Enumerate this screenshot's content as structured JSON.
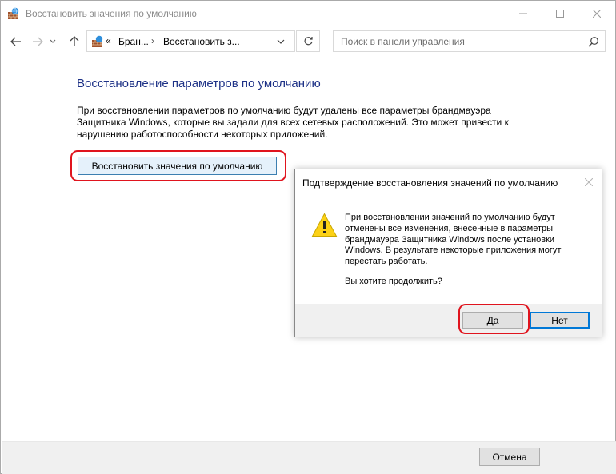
{
  "window": {
    "title": "Восстановить значения по умолчанию"
  },
  "nav": {
    "breadcrumb_overflow": "«",
    "breadcrumb_1": "Бран...",
    "breadcrumb_2": "Восстановить з...",
    "search_placeholder": "Поиск в панели управления"
  },
  "main": {
    "heading": "Восстановление параметров по умолчанию",
    "description": "При восстановлении параметров по умолчанию будут удалены все параметры брандмауэра Защитника Windows, которые вы задали для всех сетевых расположений. Это может привести к нарушению работоспособности некоторых приложений.",
    "restore_button": "Восстановить значения по умолчанию"
  },
  "dialog": {
    "title": "Подтверждение восстановления значений по умолчанию",
    "message": "При восстановлении значений по умолчанию будут отменены все изменения, внесенные в параметры брандмауэра Защитника Windows после установки Windows. В результате некоторые приложения могут перестать работать.",
    "question": "Вы хотите продолжить?",
    "yes_button": "Да",
    "no_button": "Нет"
  },
  "footer": {
    "cancel_button": "Отмена"
  },
  "colors": {
    "heading": "#1e3287",
    "highlight": "#e0141e",
    "accent": "#0078d7"
  },
  "icons": [
    "firewall-app-icon",
    "back-arrow-icon",
    "forward-arrow-icon",
    "chevron-down-icon",
    "up-arrow-icon",
    "refresh-icon",
    "search-icon",
    "close-icon",
    "warning-icon",
    "minimize-icon",
    "maximize-icon"
  ]
}
